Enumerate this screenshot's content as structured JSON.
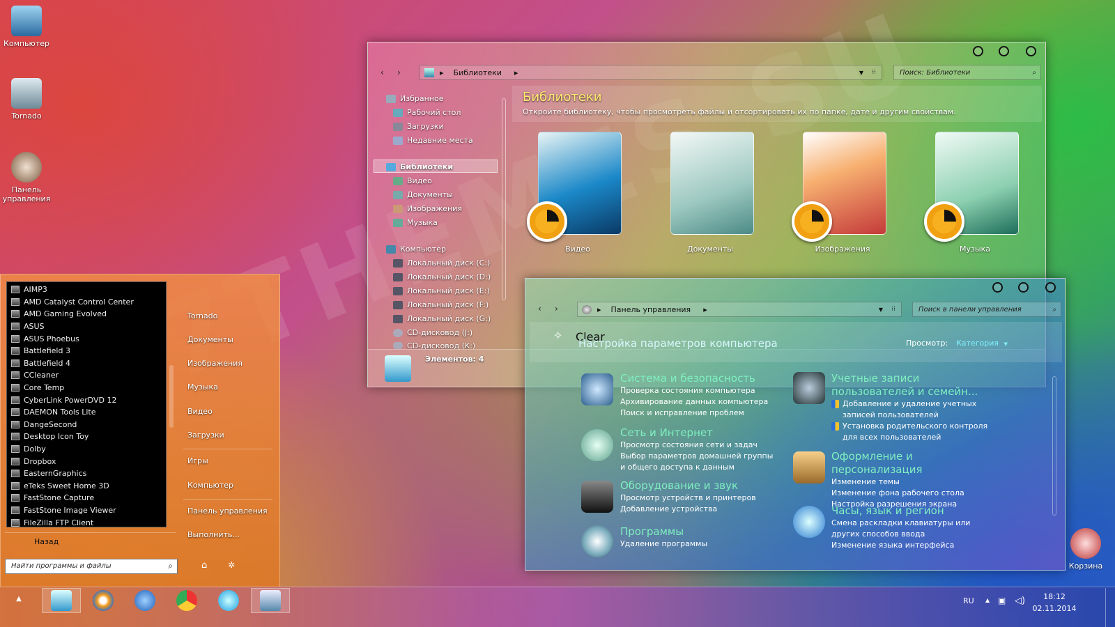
{
  "desktop": {
    "icons": [
      {
        "label": "Компьютер"
      },
      {
        "label": "Tornado"
      },
      {
        "label": "Панель управления"
      }
    ],
    "watermark": "7THEMES.SU",
    "recycle_label": "Корзина"
  },
  "explorer": {
    "breadcrumb": "Библиотеки",
    "search_placeholder": "Поиск: Библиотеки",
    "nav": {
      "favorites": "Избранное",
      "fav_items": [
        "Рабочий стол",
        "Загрузки",
        "Недавние места"
      ],
      "libraries": "Библиотеки",
      "lib_items": [
        "Видео",
        "Документы",
        "Изображения",
        "Музыка"
      ],
      "computer": "Компьютер",
      "comp_items": [
        "Локальный диск (C:)",
        "Локальный диск (D:)",
        "Локальный диск (E:)",
        "Локальный диск (F:)",
        "Локальный диск (G:)",
        "CD-дисковод (J:)",
        "CD-дисковод (K:)"
      ]
    },
    "title": "Библиотеки",
    "subtitle": "Откройте библиотеку, чтобы просмотреть файлы и отсортировать их по папке, дате и другим свойствам.",
    "tiles": [
      "Видео",
      "Документы",
      "Изображения",
      "Музыка"
    ],
    "status": "Элементов: 4"
  },
  "control_panel": {
    "breadcrumb": "Панель управления",
    "search_placeholder": "Поиск в панели управления",
    "theme_name": "Clear",
    "title": "Настройка параметров компьютера",
    "view_label": "Просмотр:",
    "view_value": "Категория",
    "categories_left": [
      {
        "title": "Система и безопасность",
        "links": [
          "Проверка состояния компьютера",
          "Архивирование данных компьютера",
          "Поиск и исправление проблем"
        ]
      },
      {
        "title": "Сеть и Интернет",
        "links": [
          "Просмотр состояния сети и задач",
          "Выбор параметров домашней группы и общего доступа к данным"
        ]
      },
      {
        "title": "Оборудование и звук",
        "links": [
          "Просмотр устройств и принтеров",
          "Добавление устройства"
        ]
      },
      {
        "title": "Программы",
        "links": [
          "Удаление программы"
        ]
      }
    ],
    "categories_right": [
      {
        "title": "Учетные записи пользователей и семейн...",
        "links": [
          "Добавление и удаление учетных записей пользователей",
          "Установка родительского контроля для всех пользователей"
        ]
      },
      {
        "title": "Оформление и персонализация",
        "links": [
          "Изменение темы",
          "Изменение фона рабочего стола",
          "Настройка разрешения экрана"
        ]
      },
      {
        "title": "Часы, язык и регион",
        "links": [
          "Смена раскладки клавиатуры или других способов ввода",
          "Изменение языка интерфейса"
        ]
      }
    ]
  },
  "start_menu": {
    "programs": [
      "AIMP3",
      "AMD Catalyst Control Center",
      "AMD Gaming Evolved",
      "ASUS",
      "ASUS Phoebus",
      "Battlefield 3",
      "Battlefield 4",
      "CCleaner",
      "Core Temp",
      "CyberLink PowerDVD 12",
      "DAEMON Tools Lite",
      "DangeSecond",
      "Desktop Icon Toy",
      "Dolby",
      "Dropbox",
      "EasternGraphics",
      "eTeks Sweet Home 3D",
      "FastStone Capture",
      "FastStone Image Viewer",
      "FileZilla FTP Client"
    ],
    "back_label": "Назад",
    "search_placeholder": "Найти программы и файлы",
    "right_items": [
      "Tornado",
      "Документы",
      "Изображения",
      "Музыка",
      "Видео",
      "Загрузки",
      "Игры",
      "Компьютер",
      "Панель управления",
      "Выполнить..."
    ]
  },
  "taskbar": {
    "lang": "RU",
    "time": "18:12",
    "date": "02.11.2014"
  }
}
